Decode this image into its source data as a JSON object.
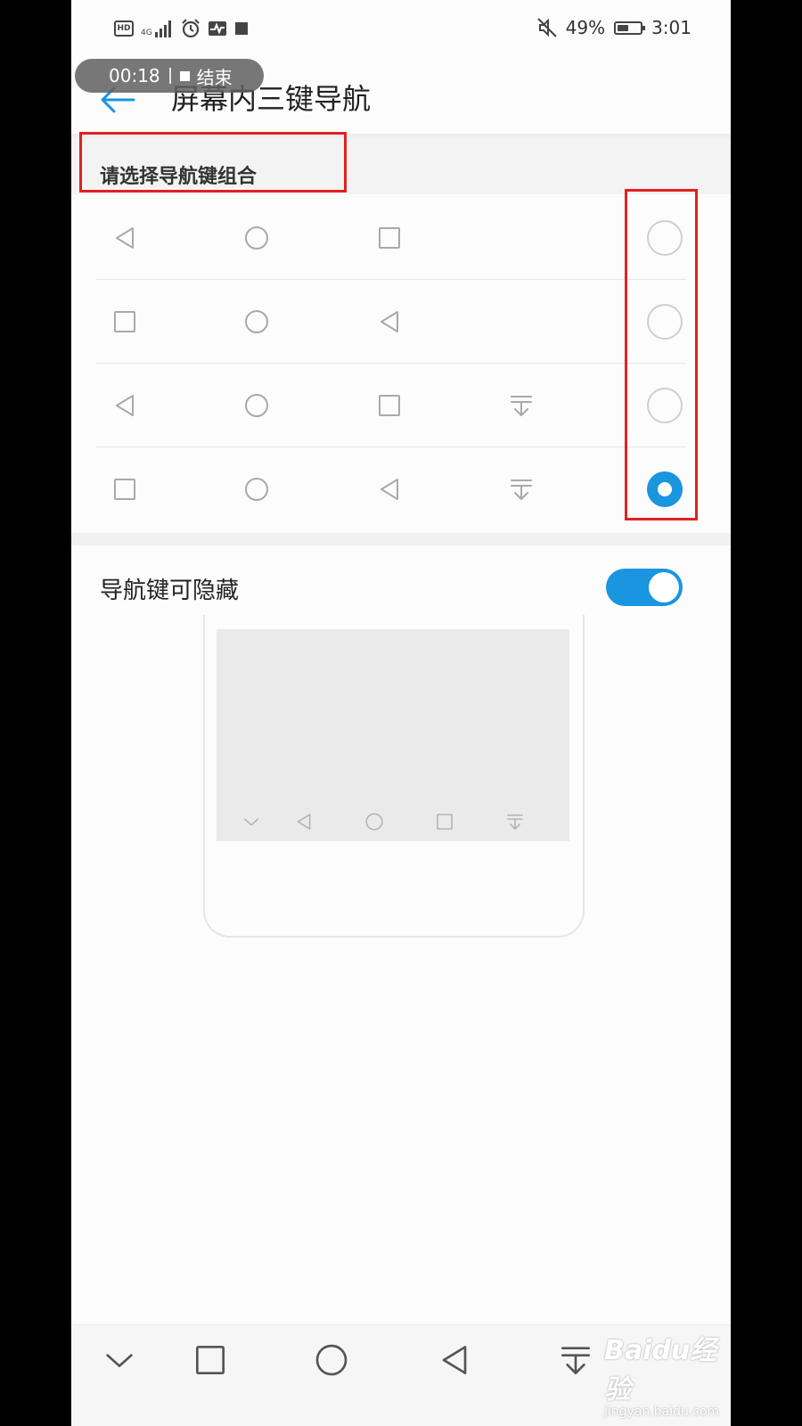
{
  "status_bar": {
    "left_badge": "HD",
    "network": "4G",
    "battery_percent": "49%",
    "battery_level": 0.49,
    "time": "3:01"
  },
  "recording": {
    "elapsed": "00:18",
    "end_label": "结束"
  },
  "header": {
    "title": "屏幕内三键导航"
  },
  "section": {
    "label": "请选择导航键组合"
  },
  "options": [
    {
      "keys": [
        "back-icon",
        "home-icon",
        "recents-icon"
      ],
      "selected": false
    },
    {
      "keys": [
        "recents-icon",
        "home-icon",
        "back-icon"
      ],
      "selected": false
    },
    {
      "keys": [
        "back-icon",
        "home-icon",
        "recents-icon",
        "notification-pull-icon"
      ],
      "selected": false
    },
    {
      "keys": [
        "recents-icon",
        "home-icon",
        "back-icon",
        "notification-pull-icon"
      ],
      "selected": true
    }
  ],
  "hide_toggle": {
    "label": "导航键可隐藏",
    "on": true
  },
  "preview": {
    "nav_keys": [
      "chevron-down-icon",
      "back-icon",
      "home-icon",
      "recents-icon",
      "notification-pull-icon"
    ]
  },
  "system_nav": {
    "keys": [
      "chevron-down-icon",
      "recents-icon",
      "home-icon",
      "back-icon",
      "notification-pull-icon"
    ]
  },
  "watermark": {
    "main": "Baidu经验",
    "sub": "jingyan.baidu.com"
  },
  "colors": {
    "accent": "#1a95e0",
    "highlight": "#e3201f",
    "icon": "#a9a9a9"
  }
}
